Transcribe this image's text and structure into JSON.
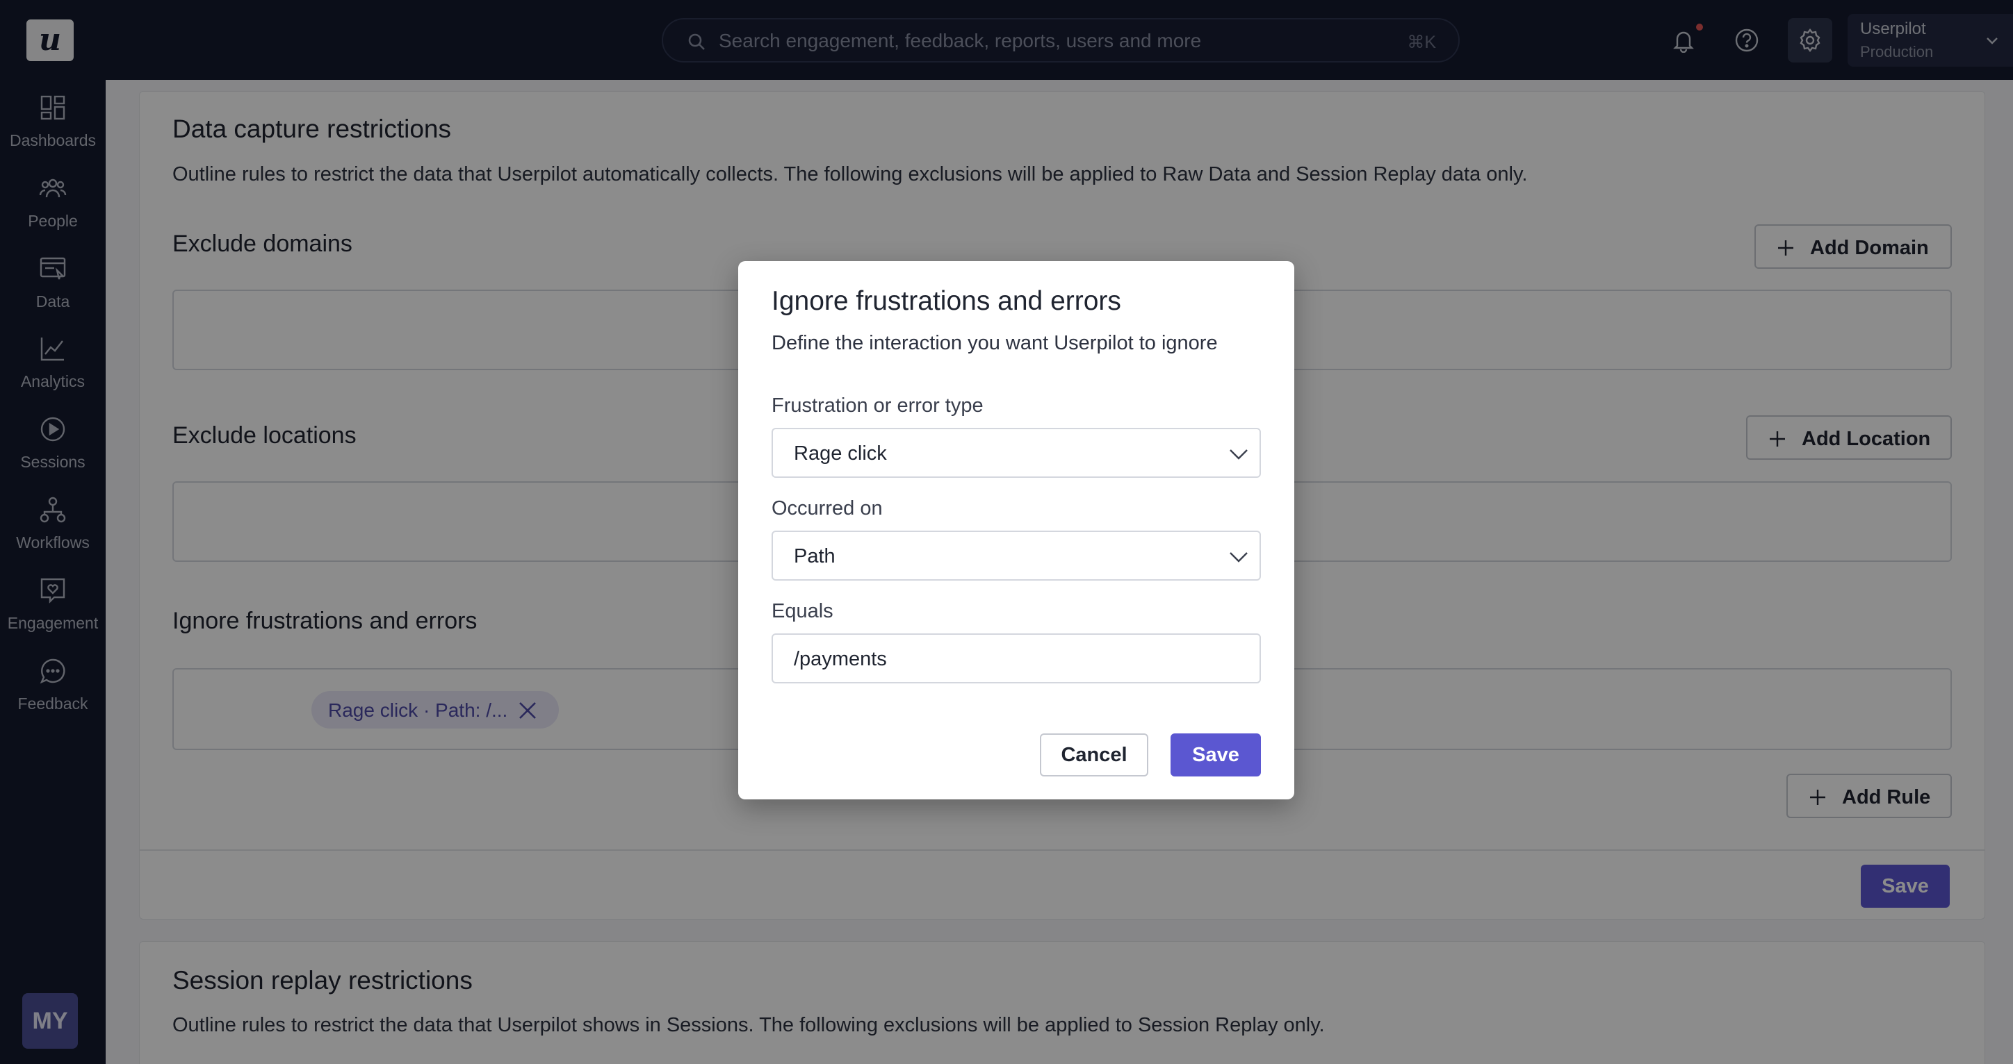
{
  "app": {
    "logo_letter": "u",
    "search_placeholder": "Search engagement, feedback, reports, users and more",
    "search_shortcut": "⌘K",
    "workspace_name": "Userpilot",
    "workspace_env": "Production",
    "avatar_initials": "MY"
  },
  "sidebar": {
    "items": [
      {
        "label": "Dashboards",
        "icon": "dashboard-icon"
      },
      {
        "label": "People",
        "icon": "people-icon"
      },
      {
        "label": "Data",
        "icon": "data-icon"
      },
      {
        "label": "Analytics",
        "icon": "analytics-icon"
      },
      {
        "label": "Sessions",
        "icon": "play-icon"
      },
      {
        "label": "Workflows",
        "icon": "workflow-icon"
      },
      {
        "label": "Engagement",
        "icon": "engagement-icon"
      },
      {
        "label": "Feedback",
        "icon": "feedback-icon"
      }
    ]
  },
  "main": {
    "data_capture": {
      "title": "Data capture restrictions",
      "description": "Outline rules to restrict the data that Userpilot automatically collects. The following exclusions will be applied to Raw Data and Session Replay data only.",
      "exclude_domains_title": "Exclude domains",
      "add_domain_label": "Add Domain",
      "exclude_locations_title": "Exclude locations",
      "add_location_label": "Add Location",
      "ignore_title": "Ignore frustrations and errors",
      "chip_label": "Rage click · Path: /...",
      "add_rule_label": "Add Rule",
      "save_label": "Save"
    },
    "session_replay": {
      "title": "Session replay restrictions",
      "description": "Outline rules to restrict the data that Userpilot shows in Sessions. The following exclusions will be applied to Session Replay only."
    }
  },
  "modal": {
    "title": "Ignore frustrations and errors",
    "description": "Define the interaction you want Userpilot to ignore",
    "type_label": "Frustration or error type",
    "type_value": "Rage click",
    "occurred_label": "Occurred on",
    "occurred_value": "Path",
    "equals_label": "Equals",
    "equals_value": "/payments",
    "cancel_label": "Cancel",
    "save_label": "Save"
  },
  "colors": {
    "topbar": "#141a2e",
    "accent": "#5b57d1",
    "chip_bg": "#e9e8f8",
    "notification_dot": "#e25555"
  }
}
